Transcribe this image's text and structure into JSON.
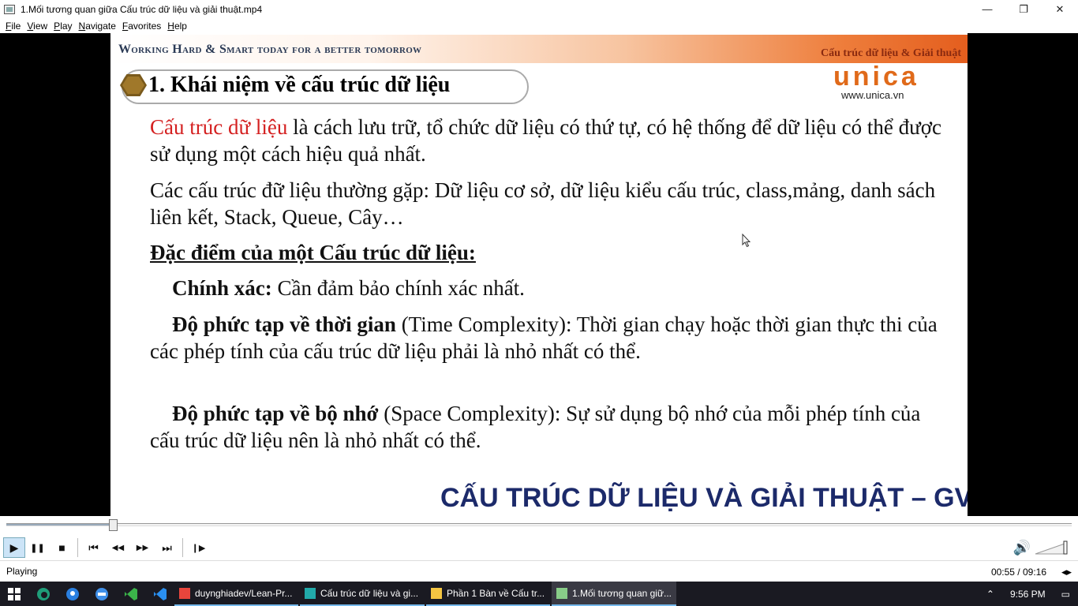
{
  "window": {
    "title": "1.Mối tương quan giữa Cấu trúc dữ liệu và giải thuật.mp4",
    "minimize": "—",
    "maximize": "❐",
    "close": "✕"
  },
  "menu": [
    "File",
    "View",
    "Play",
    "Navigate",
    "Favorites",
    "Help"
  ],
  "slide": {
    "motto": "Working Hard & Smart today for a better tomorrow",
    "topic": "Cấu trúc dữ liệu & Giải thuật",
    "section_title": "1. Khái niệm về cấu trúc dữ liệu",
    "logo": "unica",
    "logo_url": "www.unica.vn",
    "p1_term": "Cấu trúc dữ liệu",
    "p1_rest": " là cách lưu trữ, tổ chức dữ liệu có thứ tự, có hệ thống để dữ liệu có thể được sử dụng một cách hiệu quả nhất.",
    "p2": "Các cấu trúc đữ liệu thường gặp: Dữ liệu cơ sở, dữ liệu kiểu cấu trúc, class,mảng, danh sách liên kết, Stack, Queue, Cây…",
    "p3_heading": "Đặc điểm của một Cấu trúc dữ liệu:",
    "p4_bold": "Chính xác:",
    "p4_rest": " Cần đảm bảo chính xác nhất.",
    "p5_bold": "Độ phức tạp về thời gian",
    "p5_rest": " (Time Complexity): Thời gian chạy hoặc thời gian thực thi của các phép tính của cấu trúc dữ liệu phải là nhỏ nhất có thể.",
    "p6_bold": "Độ phức tạp về bộ nhớ",
    "p6_rest": " (Space Complexity): Sự sử dụng bộ nhớ của mỗi phép tính của cấu trúc dữ liệu nên là nhỏ nhất có thể.",
    "footer_banner": "CẤU TRÚC DỮ LIỆU VÀ GIẢI THUẬT – GV"
  },
  "player": {
    "progress": 0.1,
    "controls": {
      "play": "▶",
      "pause": "❚❚",
      "stop": "■",
      "prev": "⏮",
      "rewind": "◀◀",
      "forward": "▶▶",
      "next": "⏭",
      "frame_step": "❙▶"
    },
    "volume_icon": "🔊",
    "status": "Playing",
    "time": "00:55 / 09:16"
  },
  "taskbar": {
    "apps": [
      {
        "label": "duynghiadev/Lean-Pr...",
        "icon": "chrome-icon",
        "color": "#e8453c"
      },
      {
        "label": "Cấu trúc dữ liệu và gi...",
        "icon": "code-icon",
        "color": "#2aa"
      },
      {
        "label": "Phần 1 Bàn về Cấu tr...",
        "icon": "note-icon",
        "color": "#f4c542"
      },
      {
        "label": "1.Mối tương quan giữ...",
        "icon": "player-icon",
        "color": "#8c8"
      }
    ],
    "time": "9:56 PM"
  }
}
